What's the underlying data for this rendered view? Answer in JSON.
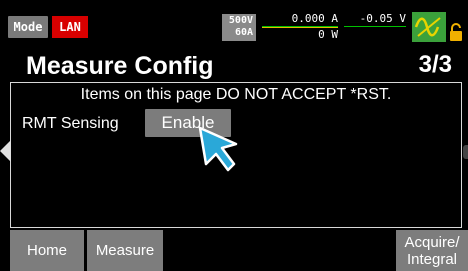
{
  "status_bar": {
    "mode_label": "Mode",
    "interface_badge": "LAN",
    "range_voltage": "500V",
    "range_current": "60A",
    "current_reading": "0.000 A",
    "power_reading": "0 W",
    "voltage_reading": "-0.05 V",
    "output_icon": "sine-wave-icon",
    "lock_icon": "lock-icon",
    "colors": {
      "lan": "#d80000",
      "output": "#3ba13b",
      "lock": "#f0b000"
    }
  },
  "header": {
    "title": "Measure Config",
    "page_indicator": "3/3"
  },
  "panel": {
    "notice": "Items on this page DO NOT ACCEPT *RST.",
    "setting_label": "RMT Sensing",
    "setting_value": "Enable"
  },
  "softkeys": {
    "home": "Home",
    "measure": "Measure",
    "acquire_line1": "Acquire/",
    "acquire_line2": "Integral"
  }
}
